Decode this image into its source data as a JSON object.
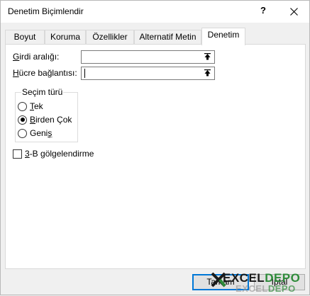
{
  "window": {
    "title": "Denetim Biçimlendir",
    "help_label": "?",
    "close_icon": "close-icon"
  },
  "tabs": [
    {
      "label": "Boyut",
      "active": false
    },
    {
      "label": "Koruma",
      "active": false
    },
    {
      "label": "Özellikler",
      "active": false
    },
    {
      "label": "Alternatif Metin",
      "active": false
    },
    {
      "label": "Denetim",
      "active": true
    }
  ],
  "control": {
    "input_range": {
      "label_ul": "G",
      "label_rest": "irdi aralığı:",
      "value": ""
    },
    "cell_link": {
      "label_ul": "H",
      "label_rest": "ücre bağlantısı:",
      "value": ""
    },
    "ref_icon": "collapse-dialog-icon",
    "selection_type": {
      "title": "Seçim türü",
      "options": [
        {
          "ul": "T",
          "rest": "ek",
          "selected": false
        },
        {
          "ul": "B",
          "rest": "irden Çok",
          "selected": true
        },
        {
          "ul": "",
          "pre": "Geni",
          "ul2": "ş",
          "rest": "",
          "selected": false
        }
      ]
    },
    "shading": {
      "ul": "3",
      "rest": "-B gölgelendirme",
      "checked": false
    }
  },
  "buttons": {
    "ok_label": "Tamam",
    "cancel_label": "İptal"
  },
  "watermark": {
    "line1_a": "EXCEL",
    "line1_b": "DEPO",
    "line2_a": "EXCEL",
    "line2_b": "DEPO"
  },
  "colors": {
    "accent": "#0078d7",
    "watermark_green": "#2e8b3a"
  }
}
